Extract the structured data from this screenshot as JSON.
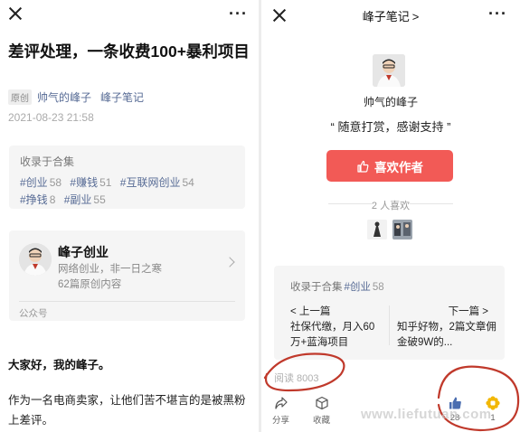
{
  "left": {
    "title": "差评处理，一条收费100+暴利项目",
    "original_badge": "原创",
    "author": "帅气的峰子",
    "account": "峰子笔记",
    "date": "2021-08-23 21:58",
    "collection": {
      "label": "收录于合集",
      "tags": [
        {
          "name": "#创业",
          "count": "58"
        },
        {
          "name": "#赚钱",
          "count": "51"
        },
        {
          "name": "#互联网创业",
          "count": "54"
        },
        {
          "name": "#挣钱",
          "count": "8"
        },
        {
          "name": "#副业",
          "count": "55"
        }
      ]
    },
    "account_card": {
      "name": "峰子创业",
      "desc": "网络创业，非一日之寒",
      "count": "62篇原创内容",
      "footer": "公众号"
    },
    "para1": "大家好，我的峰子。",
    "para2": "作为一名电商卖家，让他们苦不堪言的是被黑粉上差评。"
  },
  "right": {
    "nav_title": "峰子笔记",
    "nav_chevron": ">",
    "author": "帅气的峰子",
    "slogan": "“ 随意打赏，感谢支持 ”",
    "reward_button": "喜欢作者",
    "likes_text": "2 人喜欢",
    "collection": {
      "label": "收录于合集",
      "tag": "#创业",
      "count": "58",
      "prev_label": "< 上一篇",
      "next_label": "下一篇 >",
      "prev_title": "社保代缴，月入60万+蓝海项目",
      "next_title": "知乎好物，2篇文章佣金破9W的..."
    },
    "read_count": "阅读 8003",
    "bottom": {
      "share": "分享",
      "favorite": "收藏",
      "like_count": "28",
      "watch_count": "1"
    }
  },
  "watermark": "www.liefutuan.com",
  "colors": {
    "link": "#576b95",
    "reward": "#f25a56",
    "annotation": "#c0392b"
  }
}
